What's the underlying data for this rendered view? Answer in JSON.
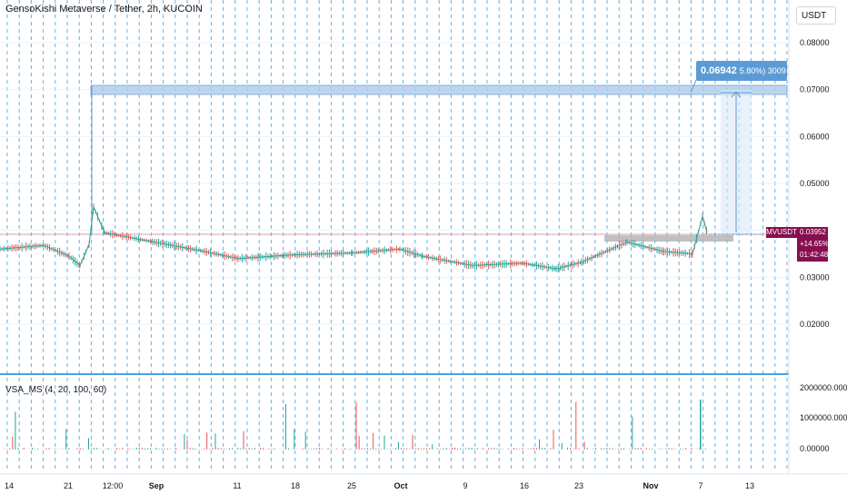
{
  "header": {
    "symbol_title": "GensoKishi Metaverse / Tether, 2h, KUCOIN",
    "currency_button": "USDT"
  },
  "indicator": {
    "label": "VSA_MS (4, 20, 100, 60)"
  },
  "price_scale": {
    "labels": [
      "0.08000",
      "0.07000",
      "0.06000",
      "0.05000",
      "0.03000",
      "0.02000"
    ]
  },
  "volume_scale": {
    "labels": [
      "2000000.00000",
      "1000000.00000",
      "0.00000"
    ]
  },
  "last_price": {
    "ticker": "MVUSDT",
    "price": "0.03952",
    "change": "+14.65%",
    "countdown": "01:42:48"
  },
  "annotation": {
    "target_price": "0.06942",
    "target_detail": "5.80%) 3009"
  },
  "time_axis": {
    "labels": [
      "14",
      "21",
      "12:00",
      "Sep",
      "11",
      "18",
      "25",
      "Oct",
      "9",
      "16",
      "23",
      "Nov",
      "7",
      "13"
    ]
  },
  "colors": {
    "up": "#26a69a",
    "down": "#ef5350",
    "grid": "#4aa3df",
    "annotation": "#5b9bd5",
    "price_tag": "#880e4f"
  },
  "chart_data": {
    "type": "line",
    "series_kind": "candlestick-like price line with volume histogram",
    "approx_price_path": [
      {
        "x": "Aug 10",
        "y": 0.036
      },
      {
        "x": "Aug 17",
        "y": 0.0368
      },
      {
        "x": "Aug 21",
        "y": 0.0345
      },
      {
        "x": "Aug 22",
        "y": 0.0325
      },
      {
        "x": "Aug 24",
        "y": 0.037
      },
      {
        "x": "Aug 25",
        "y": 0.045
      },
      {
        "x": "Aug 27",
        "y": 0.0395
      },
      {
        "x": "Sep 1",
        "y": 0.0375
      },
      {
        "x": "Sep 7",
        "y": 0.0355
      },
      {
        "x": "Sep 12",
        "y": 0.034
      },
      {
        "x": "Sep 18",
        "y": 0.0348
      },
      {
        "x": "Sep 25",
        "y": 0.0352
      },
      {
        "x": "Oct 2",
        "y": 0.036
      },
      {
        "x": "Oct 6",
        "y": 0.0345
      },
      {
        "x": "Oct 12",
        "y": 0.0325
      },
      {
        "x": "Oct 18",
        "y": 0.033
      },
      {
        "x": "Oct 22",
        "y": 0.0318
      },
      {
        "x": "Oct 26",
        "y": 0.0332
      },
      {
        "x": "Oct 30",
        "y": 0.0375
      },
      {
        "x": "Nov 3",
        "y": 0.0355
      },
      {
        "x": "Nov 6",
        "y": 0.035
      },
      {
        "x": "Nov 7",
        "y": 0.043
      },
      {
        "x": "Nov 7 (last)",
        "y": 0.03952
      }
    ],
    "ylim": [
      0.015,
      0.085
    ],
    "grid": true
  }
}
